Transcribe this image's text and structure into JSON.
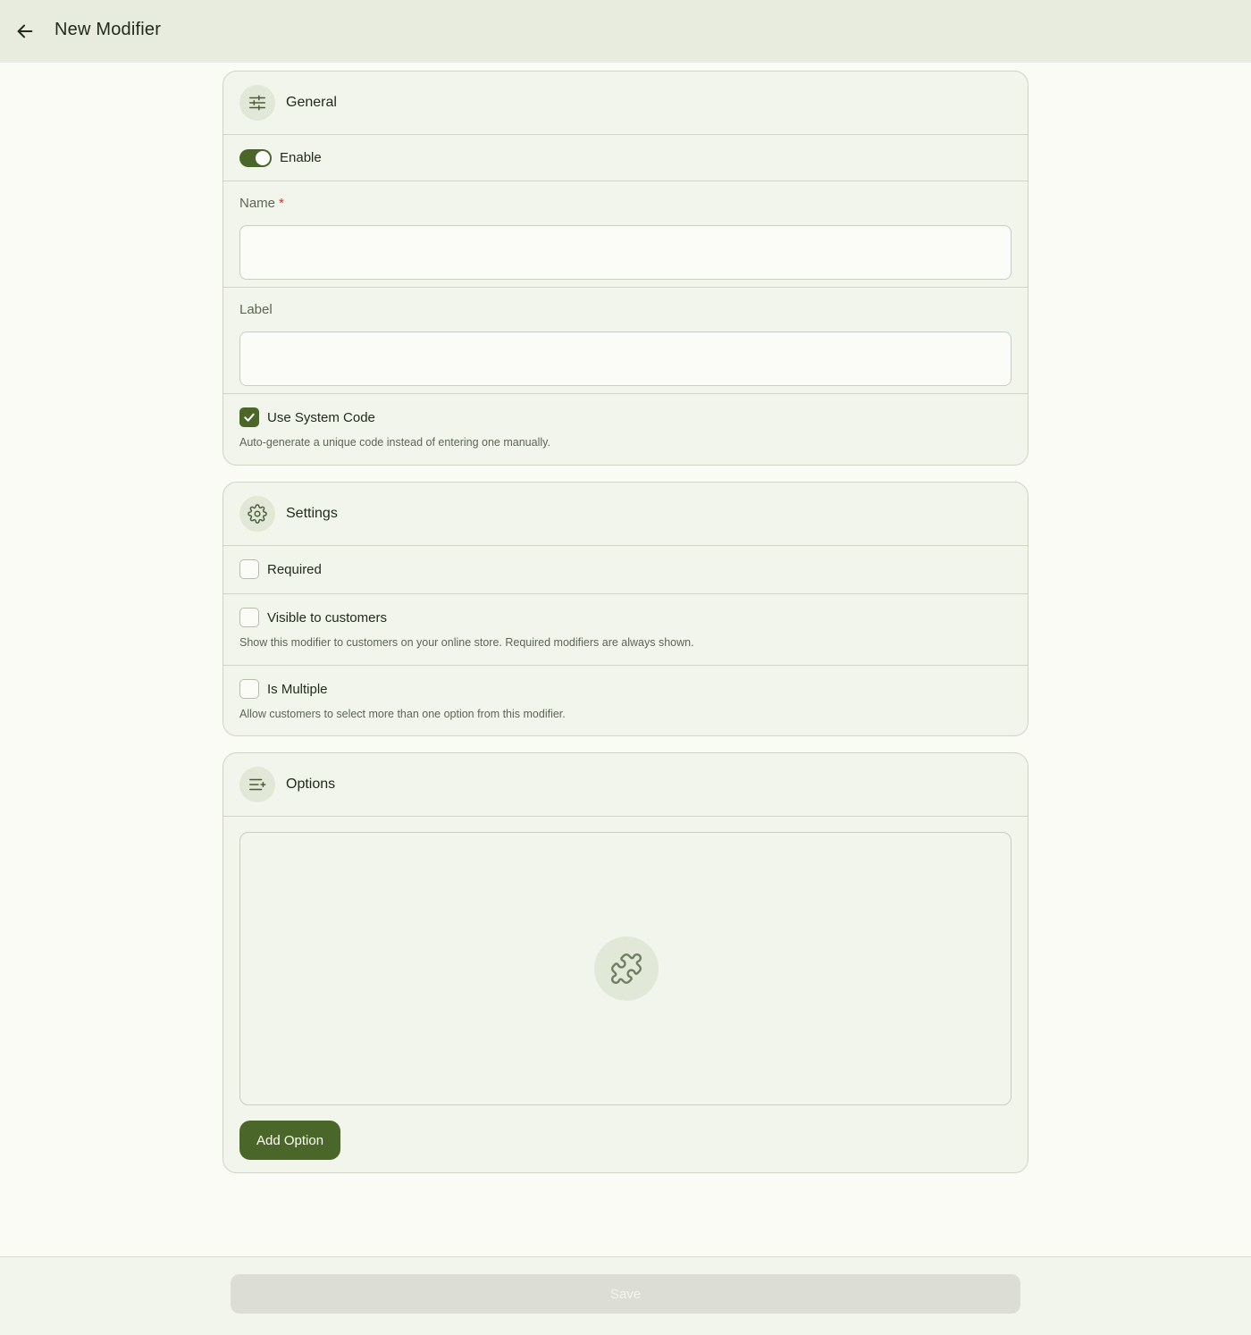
{
  "header": {
    "title": "New Modifier",
    "back_icon": "arrow-left-icon"
  },
  "general": {
    "title": "General",
    "icon": "sliders-icon",
    "enable_label": "Enable",
    "enable_on": true,
    "name_label": "Name",
    "name_required_mark": "*",
    "name_value": "",
    "label_label": "Label",
    "label_value": "",
    "system_code_label": "Use System Code",
    "system_code_checked": true,
    "system_code_helper": "Auto-generate a unique code instead of entering one manually."
  },
  "settings": {
    "title": "Settings",
    "icon": "gear-icon",
    "required_label": "Required",
    "required_checked": false,
    "visible_label": "Visible to customers",
    "visible_checked": false,
    "visible_helper": "Show this modifier to customers on your online store. Required modifiers are always shown.",
    "multiple_label": "Is Multiple",
    "multiple_checked": false,
    "multiple_helper": "Allow customers to select more than one option from this modifier."
  },
  "options": {
    "title": "Options",
    "icon": "list-add-icon",
    "empty_icon": "puzzle-icon",
    "add_button": "Add Option"
  },
  "footer": {
    "save_button": "Save"
  },
  "colors": {
    "accent": "#4a6628",
    "topbar": "#e7ecdf",
    "card": "#f2f5ec",
    "page": "#fafbf5",
    "required": "#c0392b"
  }
}
